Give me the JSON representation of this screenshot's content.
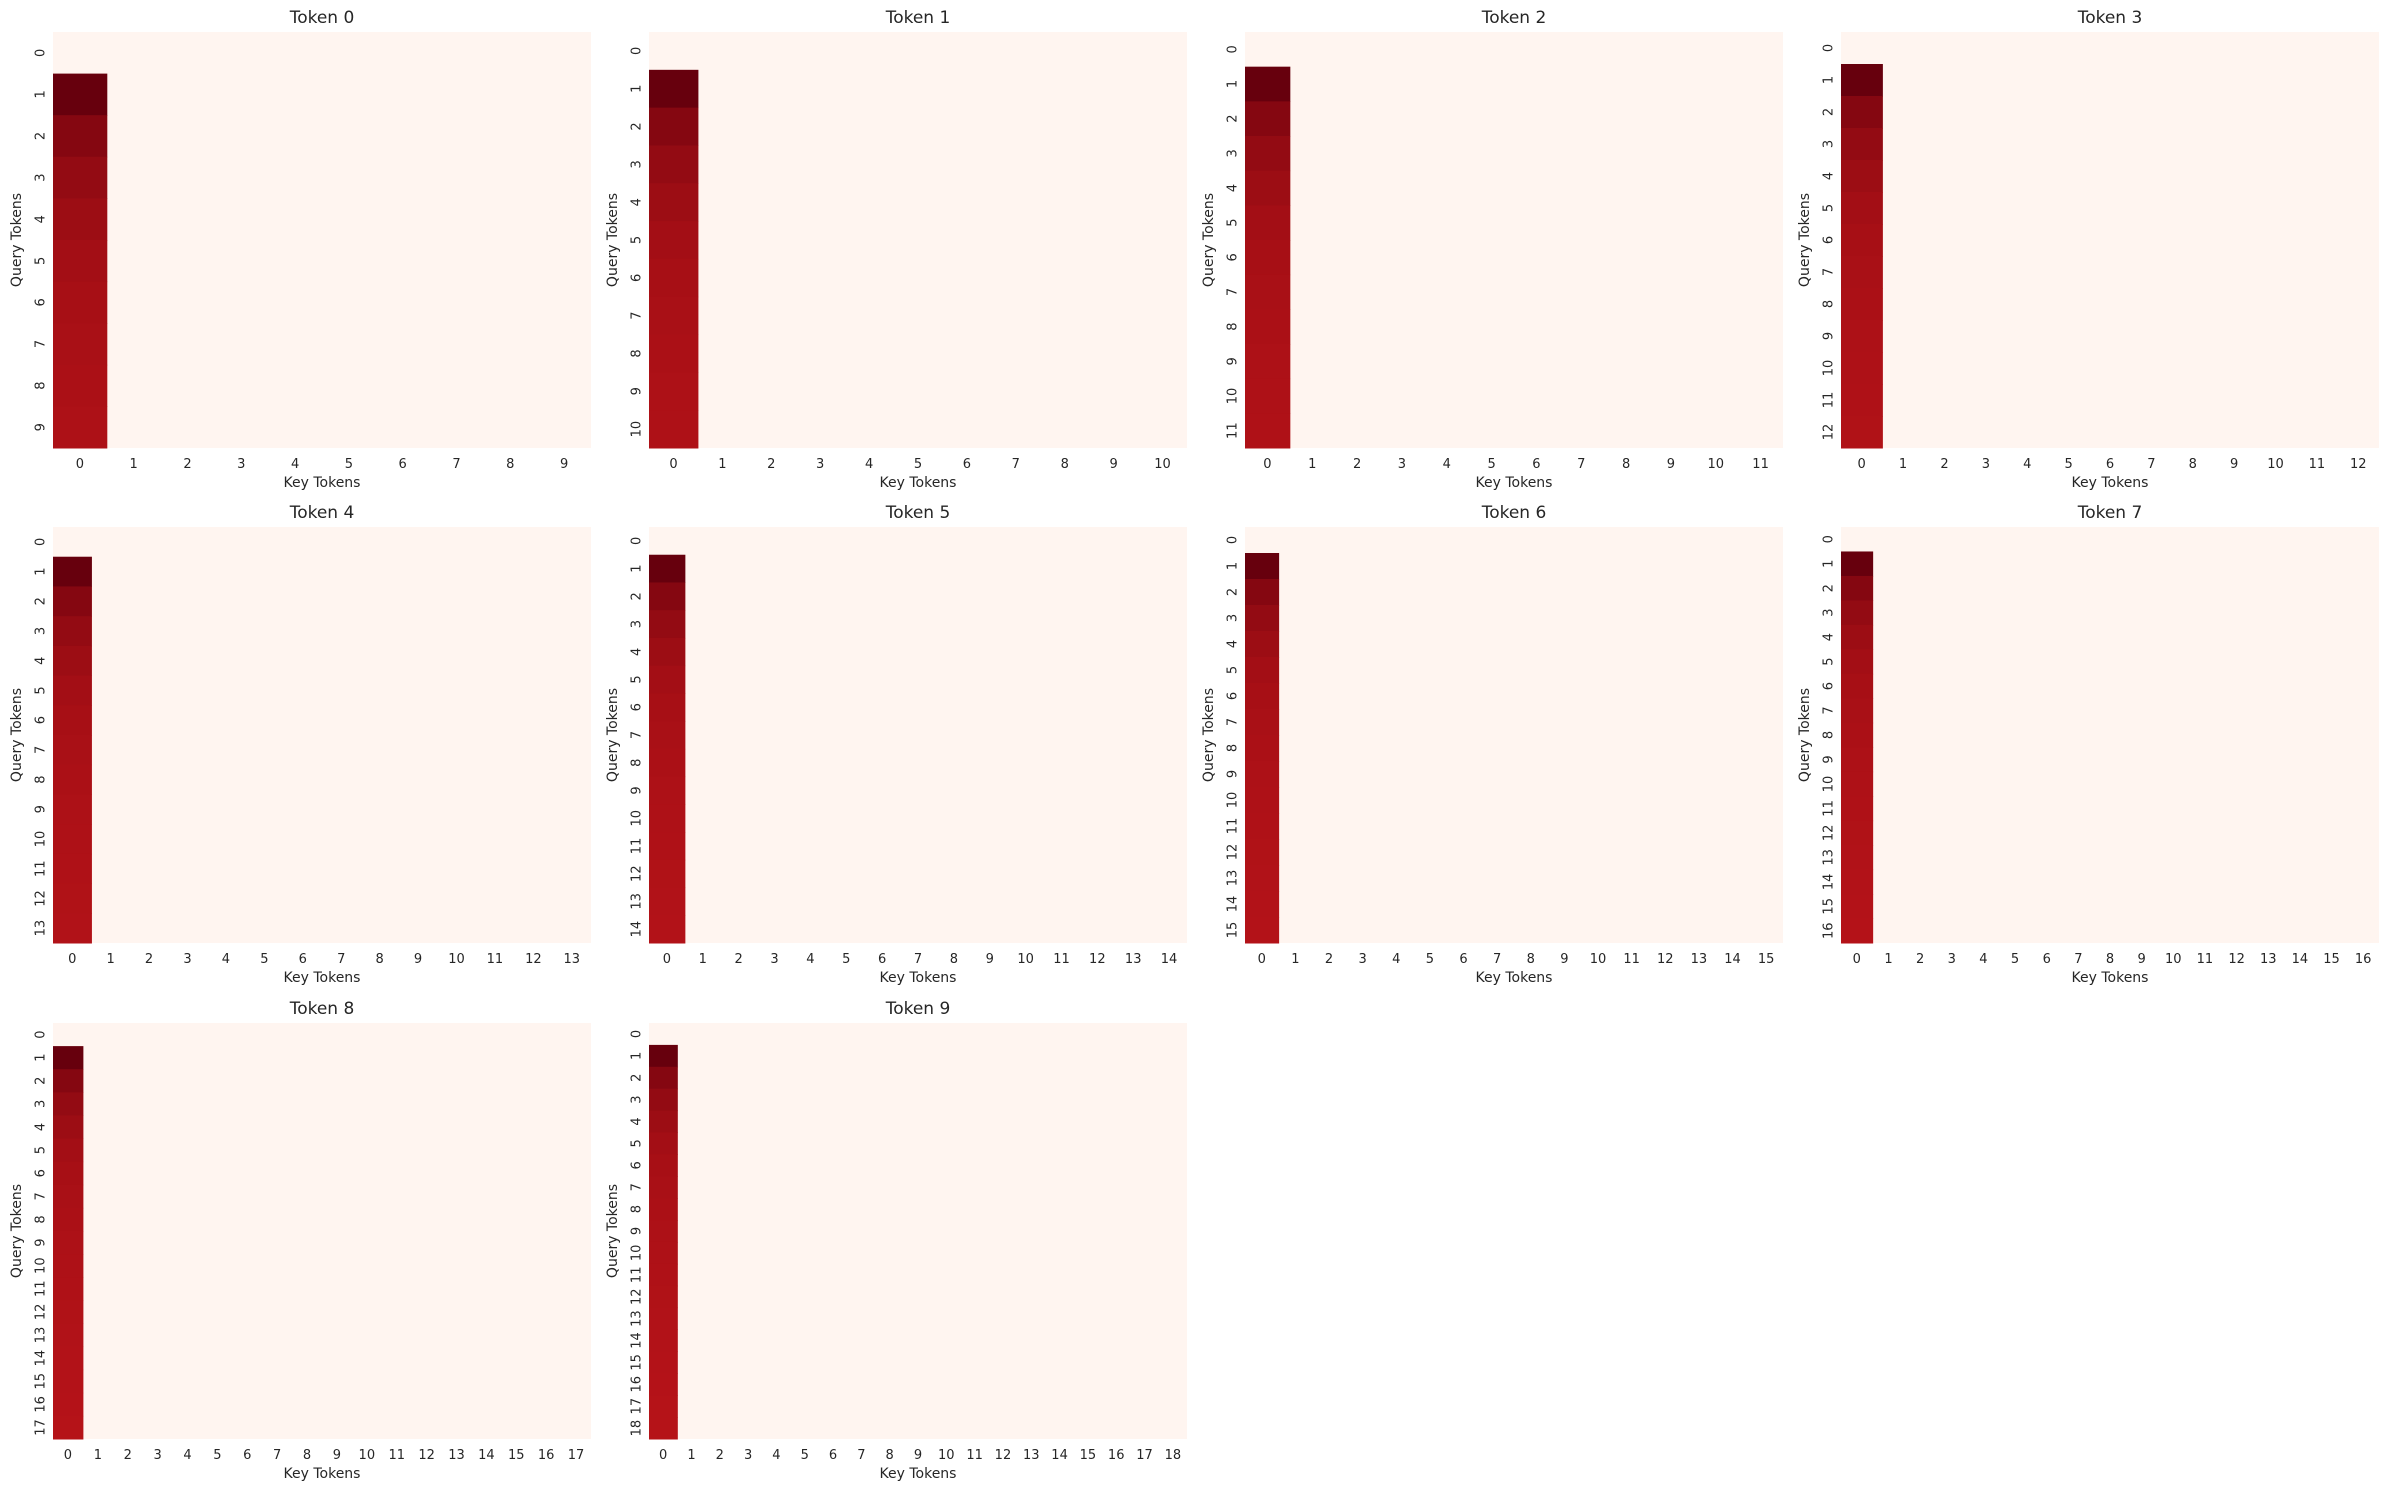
{
  "figure": {
    "background": "#ffffff"
  },
  "colormap": {
    "name": "Reds",
    "zero_color": "#fff5f0",
    "dark_color": "#67000d"
  },
  "chart_data": [
    {
      "type": "heatmap",
      "title": "Token 0",
      "xlabel": "Key Tokens",
      "ylabel": "Query Tokens",
      "size": 10,
      "nonzero_column": 0,
      "x_ticks": [
        "0",
        "1",
        "2",
        "3",
        "4",
        "5",
        "6",
        "7",
        "8",
        "9"
      ],
      "y_ticks": [
        "0",
        "1",
        "2",
        "3",
        "4",
        "5",
        "6",
        "7",
        "8",
        "9"
      ],
      "column0_values": [
        0,
        1.0,
        0.5,
        0.333,
        0.25,
        0.2,
        0.167,
        0.143,
        0.125,
        0.111
      ]
    },
    {
      "type": "heatmap",
      "title": "Token 1",
      "xlabel": "Key Tokens",
      "ylabel": "Query Tokens",
      "size": 11,
      "nonzero_column": 0,
      "x_ticks": [
        "0",
        "1",
        "2",
        "3",
        "4",
        "5",
        "6",
        "7",
        "8",
        "9",
        "10"
      ],
      "y_ticks": [
        "0",
        "1",
        "2",
        "3",
        "4",
        "5",
        "6",
        "7",
        "8",
        "9",
        "10"
      ],
      "column0_values": [
        0,
        1.0,
        0.5,
        0.333,
        0.25,
        0.2,
        0.167,
        0.143,
        0.125,
        0.111,
        0.1
      ]
    },
    {
      "type": "heatmap",
      "title": "Token 2",
      "xlabel": "Key Tokens",
      "ylabel": "Query Tokens",
      "size": 12,
      "nonzero_column": 0,
      "x_ticks": [
        "0",
        "1",
        "2",
        "3",
        "4",
        "5",
        "6",
        "7",
        "8",
        "9",
        "10",
        "11"
      ],
      "y_ticks": [
        "0",
        "1",
        "2",
        "3",
        "4",
        "5",
        "6",
        "7",
        "8",
        "9",
        "10",
        "11"
      ],
      "column0_values": [
        0,
        1.0,
        0.5,
        0.333,
        0.25,
        0.2,
        0.167,
        0.143,
        0.125,
        0.111,
        0.1,
        0.091
      ]
    },
    {
      "type": "heatmap",
      "title": "Token 3",
      "xlabel": "Key Tokens",
      "ylabel": "Query Tokens",
      "size": 13,
      "nonzero_column": 0,
      "x_ticks": [
        "0",
        "1",
        "2",
        "3",
        "4",
        "5",
        "6",
        "7",
        "8",
        "9",
        "10",
        "11",
        "12"
      ],
      "y_ticks": [
        "0",
        "1",
        "2",
        "3",
        "4",
        "5",
        "6",
        "7",
        "8",
        "9",
        "10",
        "11",
        "12"
      ],
      "column0_values": [
        0,
        1.0,
        0.5,
        0.333,
        0.25,
        0.2,
        0.167,
        0.143,
        0.125,
        0.111,
        0.1,
        0.091,
        0.083
      ]
    },
    {
      "type": "heatmap",
      "title": "Token 4",
      "xlabel": "Key Tokens",
      "ylabel": "Query Tokens",
      "size": 14,
      "nonzero_column": 0,
      "x_ticks": [
        "0",
        "1",
        "2",
        "3",
        "4",
        "5",
        "6",
        "7",
        "8",
        "9",
        "10",
        "11",
        "12",
        "13"
      ],
      "y_ticks": [
        "0",
        "1",
        "2",
        "3",
        "4",
        "5",
        "6",
        "7",
        "8",
        "9",
        "10",
        "11",
        "12",
        "13"
      ],
      "column0_values": [
        0,
        1.0,
        0.5,
        0.333,
        0.25,
        0.2,
        0.167,
        0.143,
        0.125,
        0.111,
        0.1,
        0.091,
        0.083,
        0.077
      ]
    },
    {
      "type": "heatmap",
      "title": "Token 5",
      "xlabel": "Key Tokens",
      "ylabel": "Query Tokens",
      "size": 15,
      "nonzero_column": 0,
      "x_ticks": [
        "0",
        "1",
        "2",
        "3",
        "4",
        "5",
        "6",
        "7",
        "8",
        "9",
        "10",
        "11",
        "12",
        "13",
        "14"
      ],
      "y_ticks": [
        "0",
        "1",
        "2",
        "3",
        "4",
        "5",
        "6",
        "7",
        "8",
        "9",
        "10",
        "11",
        "12",
        "13",
        "14"
      ],
      "column0_values": [
        0,
        1.0,
        0.5,
        0.333,
        0.25,
        0.2,
        0.167,
        0.143,
        0.125,
        0.111,
        0.1,
        0.091,
        0.083,
        0.077,
        0.071
      ]
    },
    {
      "type": "heatmap",
      "title": "Token 6",
      "xlabel": "Key Tokens",
      "ylabel": "Query Tokens",
      "size": 16,
      "nonzero_column": 0,
      "x_ticks": [
        "0",
        "1",
        "2",
        "3",
        "4",
        "5",
        "6",
        "7",
        "8",
        "9",
        "10",
        "11",
        "12",
        "13",
        "14",
        "15"
      ],
      "y_ticks": [
        "0",
        "1",
        "2",
        "3",
        "4",
        "5",
        "6",
        "7",
        "8",
        "9",
        "10",
        "11",
        "12",
        "13",
        "14",
        "15"
      ],
      "column0_values": [
        0,
        1.0,
        0.5,
        0.333,
        0.25,
        0.2,
        0.167,
        0.143,
        0.125,
        0.111,
        0.1,
        0.091,
        0.083,
        0.077,
        0.071,
        0.067
      ]
    },
    {
      "type": "heatmap",
      "title": "Token 7",
      "xlabel": "Key Tokens",
      "ylabel": "Query Tokens",
      "size": 17,
      "nonzero_column": 0,
      "x_ticks": [
        "0",
        "1",
        "2",
        "3",
        "4",
        "5",
        "6",
        "7",
        "8",
        "9",
        "10",
        "11",
        "12",
        "13",
        "14",
        "15",
        "16"
      ],
      "y_ticks": [
        "0",
        "1",
        "2",
        "3",
        "4",
        "5",
        "6",
        "7",
        "8",
        "9",
        "10",
        "11",
        "12",
        "13",
        "14",
        "15",
        "16"
      ],
      "column0_values": [
        0,
        1.0,
        0.5,
        0.333,
        0.25,
        0.2,
        0.167,
        0.143,
        0.125,
        0.111,
        0.1,
        0.091,
        0.083,
        0.077,
        0.071,
        0.067,
        0.063
      ]
    },
    {
      "type": "heatmap",
      "title": "Token 8",
      "xlabel": "Key Tokens",
      "ylabel": "Query Tokens",
      "size": 18,
      "nonzero_column": 0,
      "x_ticks": [
        "0",
        "1",
        "2",
        "3",
        "4",
        "5",
        "6",
        "7",
        "8",
        "9",
        "10",
        "11",
        "12",
        "13",
        "14",
        "15",
        "16",
        "17"
      ],
      "y_ticks": [
        "0",
        "1",
        "2",
        "3",
        "4",
        "5",
        "6",
        "7",
        "8",
        "9",
        "10",
        "11",
        "12",
        "13",
        "14",
        "15",
        "16",
        "17"
      ],
      "column0_values": [
        0,
        1.0,
        0.5,
        0.333,
        0.25,
        0.2,
        0.167,
        0.143,
        0.125,
        0.111,
        0.1,
        0.091,
        0.083,
        0.077,
        0.071,
        0.067,
        0.063,
        0.059
      ]
    },
    {
      "type": "heatmap",
      "title": "Token 9",
      "xlabel": "Key Tokens",
      "ylabel": "Query Tokens",
      "size": 19,
      "nonzero_column": 0,
      "x_ticks": [
        "0",
        "1",
        "2",
        "3",
        "4",
        "5",
        "6",
        "7",
        "8",
        "9",
        "10",
        "11",
        "12",
        "13",
        "14",
        "15",
        "16",
        "17",
        "18"
      ],
      "y_ticks": [
        "0",
        "1",
        "2",
        "3",
        "4",
        "5",
        "6",
        "7",
        "8",
        "9",
        "10",
        "11",
        "12",
        "13",
        "14",
        "15",
        "16",
        "17",
        "18"
      ],
      "column0_values": [
        0,
        1.0,
        0.5,
        0.333,
        0.25,
        0.2,
        0.167,
        0.143,
        0.125,
        0.111,
        0.1,
        0.091,
        0.083,
        0.077,
        0.071,
        0.067,
        0.063,
        0.059,
        0.056
      ]
    }
  ]
}
